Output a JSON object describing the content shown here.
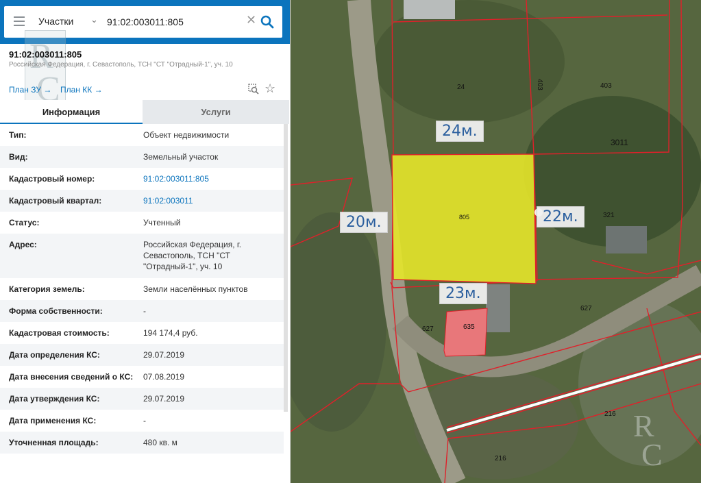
{
  "search": {
    "type_label": "Участки",
    "value": "91:02:003011:805"
  },
  "object": {
    "title": "91:02:003011:805",
    "address": "Российская Федерация, г. Севастополь, ТСН \"СТ \"Отрадный-1\", уч. 10",
    "plan_zu": "План ЗУ",
    "plan_kk": "План КК"
  },
  "tabs": {
    "info": "Информация",
    "services": "Услуги"
  },
  "properties": [
    {
      "label": "Тип:",
      "value": "Объект недвижимости"
    },
    {
      "label": "Вид:",
      "value": "Земельный участок"
    },
    {
      "label": "Кадастровый номер:",
      "value": "91:02:003011:805"
    },
    {
      "label": "Кадастровый квартал:",
      "value": "91:02:003011"
    },
    {
      "label": "Статус:",
      "value": "Учтенный"
    },
    {
      "label": "Адрес:",
      "value": "Российская Федерация, г. Севастополь, ТСН \"СТ \"Отрадный-1\", уч. 10"
    },
    {
      "label": "Категория земель:",
      "value": "Земли населённых пунктов"
    },
    {
      "label": "Форма собственности:",
      "value": "-"
    },
    {
      "label": "Кадастровая стоимость:",
      "value": "194 174,4 руб."
    },
    {
      "label": "Дата определения КС:",
      "value": "29.07.2019"
    },
    {
      "label": "Дата внесения сведений о КС:",
      "value": "07.08.2019"
    },
    {
      "label": "Дата утверждения КС:",
      "value": "29.07.2019"
    },
    {
      "label": "Дата применения КС:",
      "value": "-"
    },
    {
      "label": "Уточненная площадь:",
      "value": "480 кв. м"
    }
  ],
  "map": {
    "plot_numbers": [
      "24",
      "403",
      "403",
      "3011",
      "805",
      "321",
      "627",
      "627",
      "635",
      "216",
      "216"
    ],
    "dimensions": [
      "24м.",
      "20м.",
      "22м.",
      "23м."
    ],
    "highlight_color": "#e5e52a",
    "neighbor_color": "#e8777a",
    "boundary_color": "#e0202a"
  },
  "watermark": "RC",
  "icons": [
    "menu-icon",
    "chevron-down-icon",
    "clear-icon",
    "search-icon",
    "collapse-icon",
    "arrow-right-icon",
    "zoom-icon",
    "star-icon"
  ]
}
